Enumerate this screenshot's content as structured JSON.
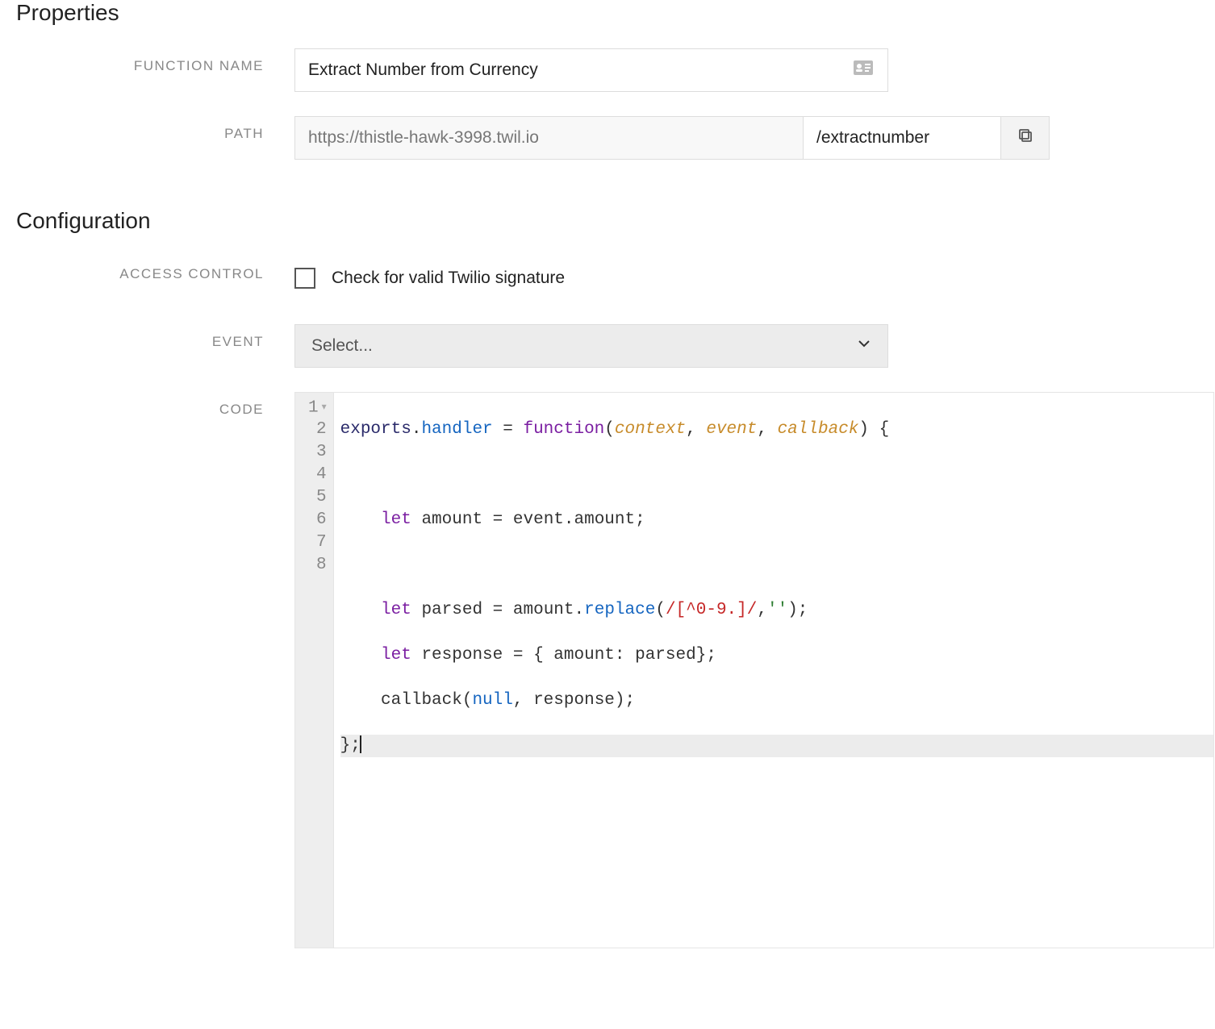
{
  "sections": {
    "properties_title": "Properties",
    "configuration_title": "Configuration"
  },
  "labels": {
    "function_name": "FUNCTION NAME",
    "path": "PATH",
    "access_control": "ACCESS CONTROL",
    "event": "EVENT",
    "code": "CODE"
  },
  "properties": {
    "function_name_value": "Extract Number from Currency",
    "path_base": "https://thistle-hawk-3998.twil.io",
    "path_suffix": "/extractnumber"
  },
  "configuration": {
    "access_control_label": "Check for valid Twilio signature",
    "access_control_checked": false,
    "event_placeholder": "Select..."
  },
  "code_editor": {
    "line_numbers": [
      "1",
      "2",
      "3",
      "4",
      "5",
      "6",
      "7",
      "8"
    ],
    "tokens": {
      "l1_exports": "exports",
      "l1_handler": "handler",
      "l1_function": "function",
      "l1_p_context": "context",
      "l1_p_event": "event",
      "l1_p_callback": "callback",
      "l3_let": "let",
      "l3_amount": " amount ",
      "l3_eq": "=",
      "l3_rhs": " event.amount;",
      "l5_let": "let",
      "l5_parsed": " parsed ",
      "l5_eq": "=",
      "l5_amountdot": " amount.",
      "l5_replace": "replace",
      "l5_open": "(",
      "l5_regex": "/[^0-9.]/",
      "l5_comma": ",",
      "l5_str": "''",
      "l5_close": ");",
      "l6_let": "let",
      "l6_resp": " response ",
      "l6_eq": "=",
      "l6_body": " { amount: parsed};",
      "l7_cb": "callback(",
      "l7_null": "null",
      "l7_rest": ", response);",
      "l8": "};"
    }
  }
}
